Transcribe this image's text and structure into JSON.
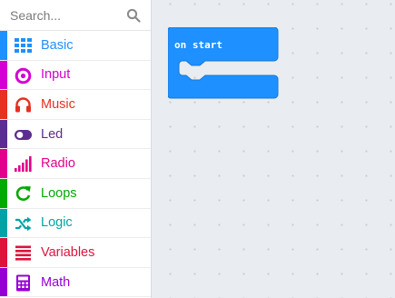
{
  "search": {
    "placeholder": "Search..."
  },
  "categories": [
    {
      "label": "Basic",
      "color": "#1e90ff",
      "icon": "grid-icon"
    },
    {
      "label": "Input",
      "color": "#d400d4",
      "icon": "circle-dot-icon"
    },
    {
      "label": "Music",
      "color": "#e63022",
      "icon": "headphones-icon"
    },
    {
      "label": "Led",
      "color": "#5c2d91",
      "icon": "toggle-icon"
    },
    {
      "label": "Radio",
      "color": "#e3008c",
      "icon": "signal-bars-icon"
    },
    {
      "label": "Loops",
      "color": "#00aa00",
      "icon": "refresh-icon"
    },
    {
      "label": "Logic",
      "color": "#00a4a6",
      "icon": "shuffle-icon"
    },
    {
      "label": "Variables",
      "color": "#dc143c",
      "icon": "list-icon"
    },
    {
      "label": "Math",
      "color": "#9400d3",
      "icon": "calculator-icon"
    }
  ],
  "workspace": {
    "block": {
      "label": "on start",
      "color": "#1e90ff"
    }
  }
}
